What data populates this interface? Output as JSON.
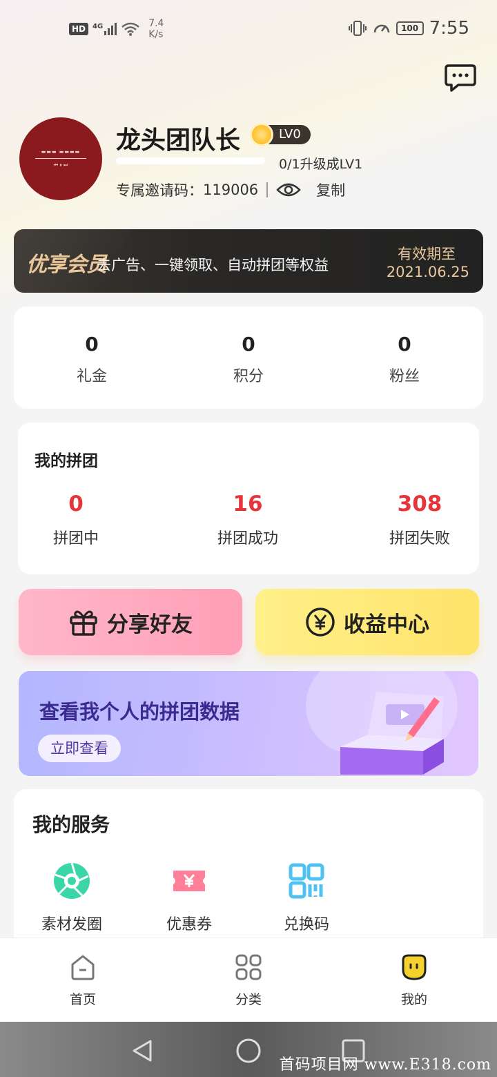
{
  "status_bar": {
    "left_badge": "HD",
    "network": "4G",
    "speed_value": "7.4",
    "speed_unit": "K/s",
    "battery": "100",
    "time": "7:55"
  },
  "profile": {
    "name": "龙头团队长",
    "level": "LV0",
    "progress_fraction": 0.0,
    "upgrade_text": "0/1升级成LV1",
    "invite_label": "专属邀请码：",
    "invite_code": "119006",
    "copy_label": "复制"
  },
  "vip": {
    "title": "优享会员",
    "description": "去广告、一键领取、自动拼团等权益",
    "expire_label": "有效期至",
    "expire_date": "2021.06.25"
  },
  "stats": [
    {
      "value": "0",
      "label": "礼金"
    },
    {
      "value": "0",
      "label": "积分"
    },
    {
      "value": "0",
      "label": "粉丝"
    }
  ],
  "group": {
    "title": "我的拼团",
    "stats": [
      {
        "value": "0",
        "label": "拼团中"
      },
      {
        "value": "16",
        "label": "拼团成功"
      },
      {
        "value": "308",
        "label": "拼团失败"
      }
    ]
  },
  "actions": {
    "share_label": "分享好友",
    "income_label": "收益中心"
  },
  "data_banner": {
    "title": "查看我个人的拼团数据",
    "button_label": "立即查看"
  },
  "services": {
    "title": "我的服务",
    "items": [
      {
        "label": "素材发圈",
        "icon": "aperture-icon"
      },
      {
        "label": "优惠券",
        "icon": "coupon-icon"
      },
      {
        "label": "兑换码",
        "icon": "qr-code-icon"
      }
    ]
  },
  "bottom_nav": [
    {
      "label": "首页",
      "icon": "home-icon"
    },
    {
      "label": "分类",
      "icon": "category-icon"
    },
    {
      "label": "我的",
      "icon": "profile-face-icon"
    }
  ],
  "colors": {
    "accent_red": "#e5343a",
    "vip_gold": "#e9c79a",
    "share_pink": "#ff9fb6",
    "income_yellow": "#ffe36a",
    "banner_purple": "#3b2a8f"
  },
  "watermark": "首码项目网 www.E318.com"
}
